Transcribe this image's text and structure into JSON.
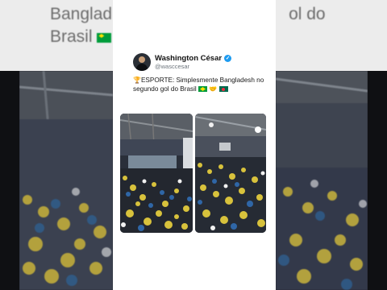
{
  "background": {
    "title_line1": "Banglad",
    "title_line1_tail": "ol do",
    "title_line2": "Brasil"
  },
  "tweet": {
    "author_name": "Washington César",
    "handle": "@wasccesar",
    "verified": true,
    "text_prefix": "ESPORTE: Simplesmente Bangladesh no segundo gol do Brasil",
    "trophy_icon": "trophy-icon",
    "emojis_after": [
      "brazil-flag",
      "handshake",
      "bangladesh-flag"
    ],
    "media_count": 2
  },
  "colors": {
    "verified_blue": "#1d9bf0",
    "brazil_green": "#009c3b",
    "brazil_yellow": "#ffdf00",
    "bangladesh_green": "#006a4e",
    "bangladesh_red": "#f42a41"
  }
}
